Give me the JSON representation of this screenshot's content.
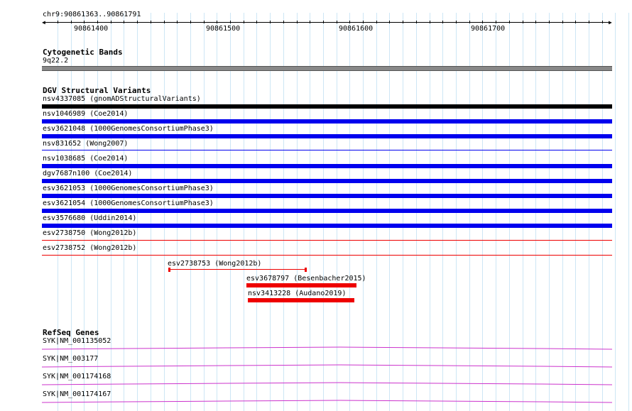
{
  "ruler": {
    "region": "chr9:90861363..90861791",
    "ticks": [
      "90861400",
      "90861500",
      "90861600",
      "90861700"
    ]
  },
  "cytoband": {
    "title": "Cytogenetic Bands",
    "band": "9q22.2"
  },
  "dgv": {
    "title": "DGV Structural Variants",
    "rows": [
      {
        "label": "nsv4337085 (gnomADStructuralVariants)",
        "color": "#000000"
      },
      {
        "label": "nsv1046989 (Coe2014)",
        "color": "#0000ee"
      },
      {
        "label": "esv3621048 (1000GenomesConsortiumPhase3)",
        "color": "#0000ee"
      },
      {
        "label": "nsv831652 (Wong2007)",
        "color": "#0000ee"
      },
      {
        "label": "nsv1038685 (Coe2014)",
        "color": "#0000ee"
      },
      {
        "label": "dgv7687n100 (Coe2014)",
        "color": "#0000ee"
      },
      {
        "label": "esv3621053 (1000GenomesConsortiumPhase3)",
        "color": "#0000ee"
      },
      {
        "label": "esv3621054 (1000GenomesConsortiumPhase3)",
        "color": "#0000ee"
      },
      {
        "label": "esv3576680 (Uddin2014)",
        "color": "#0000ee"
      },
      {
        "label": "esv2738750 (Wong2012b)",
        "color": "#ee0000"
      },
      {
        "label": "esv2738752 (Wong2012b)",
        "color": "#ee0000"
      }
    ],
    "features": [
      {
        "label": "esv2738753 (Wong2012b)",
        "color": "#ee0000"
      },
      {
        "label": "esv3678797 (Besenbacher2015)",
        "color": "#ee0000"
      },
      {
        "label": "nsv3413228 (Audano2019)",
        "color": "#ee0000"
      }
    ]
  },
  "refseq": {
    "title": "RefSeq Genes",
    "genes": [
      "SYK|NM_001135052",
      "SYK|NM_003177",
      "SYK|NM_001174168",
      "SYK|NM_001174167"
    ],
    "color": "#cc33cc"
  }
}
